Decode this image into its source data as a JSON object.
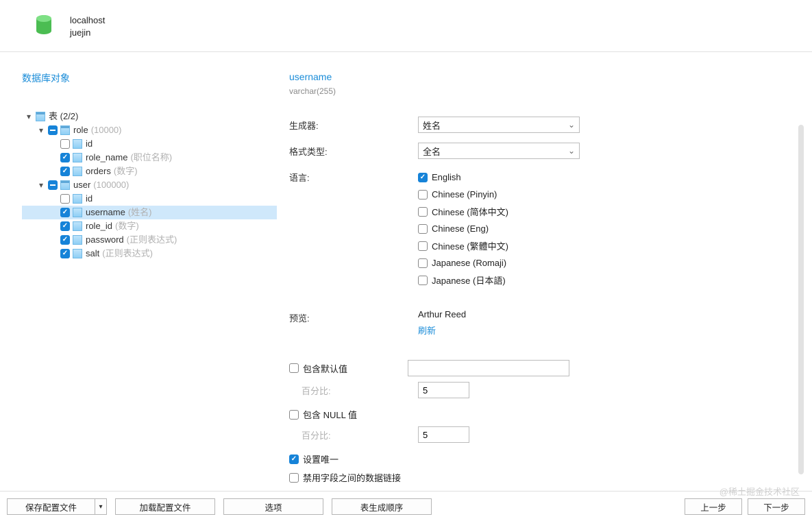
{
  "header": {
    "connection": "localhost",
    "database": "juejin"
  },
  "sidebar": {
    "title": "数据库对象",
    "tables_label": "表",
    "tables_count": "(2/2)",
    "tables": [
      {
        "name": "role",
        "rows": "(10000)",
        "checked": "minus",
        "columns": [
          {
            "name": "id",
            "meta": "",
            "checked": false
          },
          {
            "name": "role_name",
            "meta": "(职位名称)",
            "checked": true
          },
          {
            "name": "orders",
            "meta": "(数字)",
            "checked": true
          }
        ]
      },
      {
        "name": "user",
        "rows": "(100000)",
        "checked": "minus",
        "columns": [
          {
            "name": "id",
            "meta": "",
            "checked": false
          },
          {
            "name": "username",
            "meta": "(姓名)",
            "checked": true,
            "selected": true
          },
          {
            "name": "role_id",
            "meta": "(数字)",
            "checked": true
          },
          {
            "name": "password",
            "meta": "(正则表达式)",
            "checked": true
          },
          {
            "name": "salt",
            "meta": "(正则表达式)",
            "checked": true
          }
        ]
      }
    ]
  },
  "detail": {
    "column_title": "username",
    "column_type": "varchar(255)",
    "labels": {
      "generator": "生成器:",
      "format": "格式类型:",
      "language": "语言:",
      "preview": "预览:",
      "refresh": "刷新",
      "include_default": "包含默认值",
      "include_null": "包含 NULL 值",
      "percent": "百分比:",
      "set_unique": "设置唯一",
      "disable_link": "禁用字段之间的数据链接"
    },
    "generator_value": "姓名",
    "format_value": "全名",
    "languages": [
      {
        "label": "English",
        "checked": true
      },
      {
        "label": "Chinese (Pinyin)",
        "checked": false
      },
      {
        "label": "Chinese (简体中文)",
        "checked": false
      },
      {
        "label": "Chinese (Eng)",
        "checked": false
      },
      {
        "label": "Chinese (繁體中文)",
        "checked": false
      },
      {
        "label": "Japanese (Romaji)",
        "checked": false
      },
      {
        "label": "Japanese (日本語)",
        "checked": false
      }
    ],
    "preview_value": "Arthur Reed",
    "include_default_checked": false,
    "default_value": "",
    "default_percent": "5",
    "include_null_checked": false,
    "null_percent": "5",
    "set_unique_checked": true,
    "disable_link_checked": false
  },
  "footer": {
    "save_profile": "保存配置文件",
    "load_profile": "加载配置文件",
    "options": "选项",
    "table_order": "表生成顺序",
    "prev": "上一步",
    "next": "下一步"
  },
  "watermark": "@稀土掘金技术社区"
}
